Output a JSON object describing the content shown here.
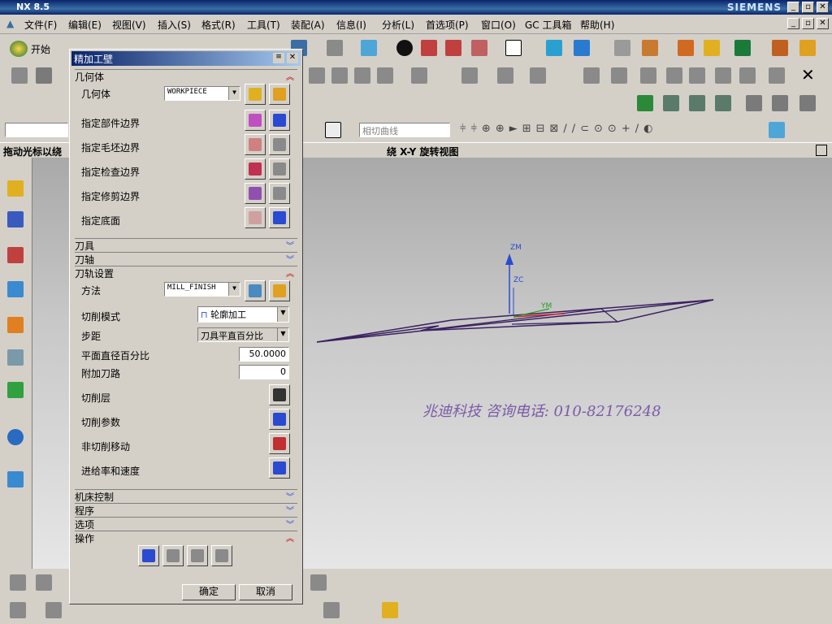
{
  "app": {
    "title": "NX 8.5",
    "brand": "SIEMENS"
  },
  "menu": [
    "文件(F)",
    "编辑(E)",
    "视图(V)",
    "插入(S)",
    "格式(R)",
    "工具(T)",
    "装配(A)",
    "信息(I)",
    "分析(L)",
    "首选项(P)",
    "窗口(O)",
    "GC 工具箱",
    "帮助(H)"
  ],
  "toolbar": {
    "start_label": "开始",
    "curve_label": "相切曲线"
  },
  "status": {
    "hint": "拖动光标以绕",
    "view": "绕 X-Y 旋转视图"
  },
  "dialog": {
    "title": "精加工壁",
    "geometry": {
      "header": "几何体",
      "geo_label": "几何体",
      "geo_value": "WORKPIECE",
      "part": "指定部件边界",
      "blank": "指定毛坯边界",
      "check": "指定检查边界",
      "trim": "指定修剪边界",
      "floor": "指定底面"
    },
    "tool_header": "刀具",
    "axis_header": "刀轴",
    "path": {
      "header": "刀轨设置",
      "method_label": "方法",
      "method_value": "MILL_FINISH",
      "cut_mode_label": "切削模式",
      "cut_mode_value": "轮廓加工",
      "step_label": "步距",
      "step_value": "刀具平直百分比",
      "plane_pct_label": "平面直径百分比",
      "plane_pct_value": "50.0000",
      "extra_label": "附加刀路",
      "extra_value": "0",
      "levels": "切削层",
      "params": "切削参数",
      "noncut": "非切削移动",
      "feeds": "进给率和速度"
    },
    "machine_header": "机床控制",
    "program_header": "程序",
    "options_header": "选项",
    "ops_header": "操作",
    "ok": "确定",
    "cancel": "取消"
  },
  "viewport": {
    "axis_zm": "ZM",
    "axis_zc": "ZC",
    "axis_ym": "YM",
    "watermark": "兆迪科技 咨询电话: 010-82176248"
  }
}
